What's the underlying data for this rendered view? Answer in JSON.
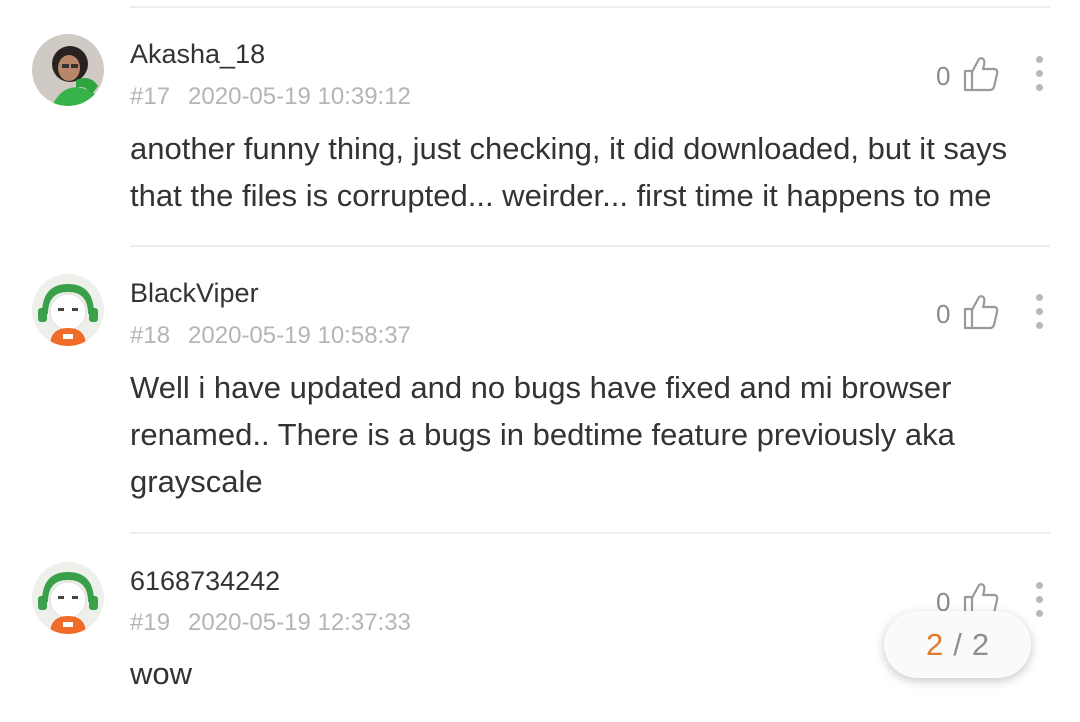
{
  "comments": [
    {
      "username": "Akasha_18",
      "floor": "#17",
      "timestamp": "2020-05-19 10:39:12",
      "likes": "0",
      "text": "another funny thing, just checking, it did downloaded, but it says that the files is corrupted... weirder... first time it happens to me"
    },
    {
      "username": "BlackViper",
      "floor": "#18",
      "timestamp": "2020-05-19 10:58:37",
      "likes": "0",
      "text": "Well i have updated and no bugs have fixed and mi browser renamed.. There is a bugs in bedtime feature previously aka grayscale"
    },
    {
      "username": "6168734242",
      "floor": "#19",
      "timestamp": "2020-05-19 12:37:33",
      "likes": "0",
      "text": "wow"
    }
  ],
  "pager": {
    "current": "2",
    "separator": "/",
    "total": "2"
  },
  "icons": {
    "like": "thumbs-up-icon",
    "more": "more-vertical-icon"
  },
  "colors": {
    "accent": "#e07a2c",
    "avatar_green": "#3aa14a",
    "avatar_orange": "#f06a28"
  }
}
